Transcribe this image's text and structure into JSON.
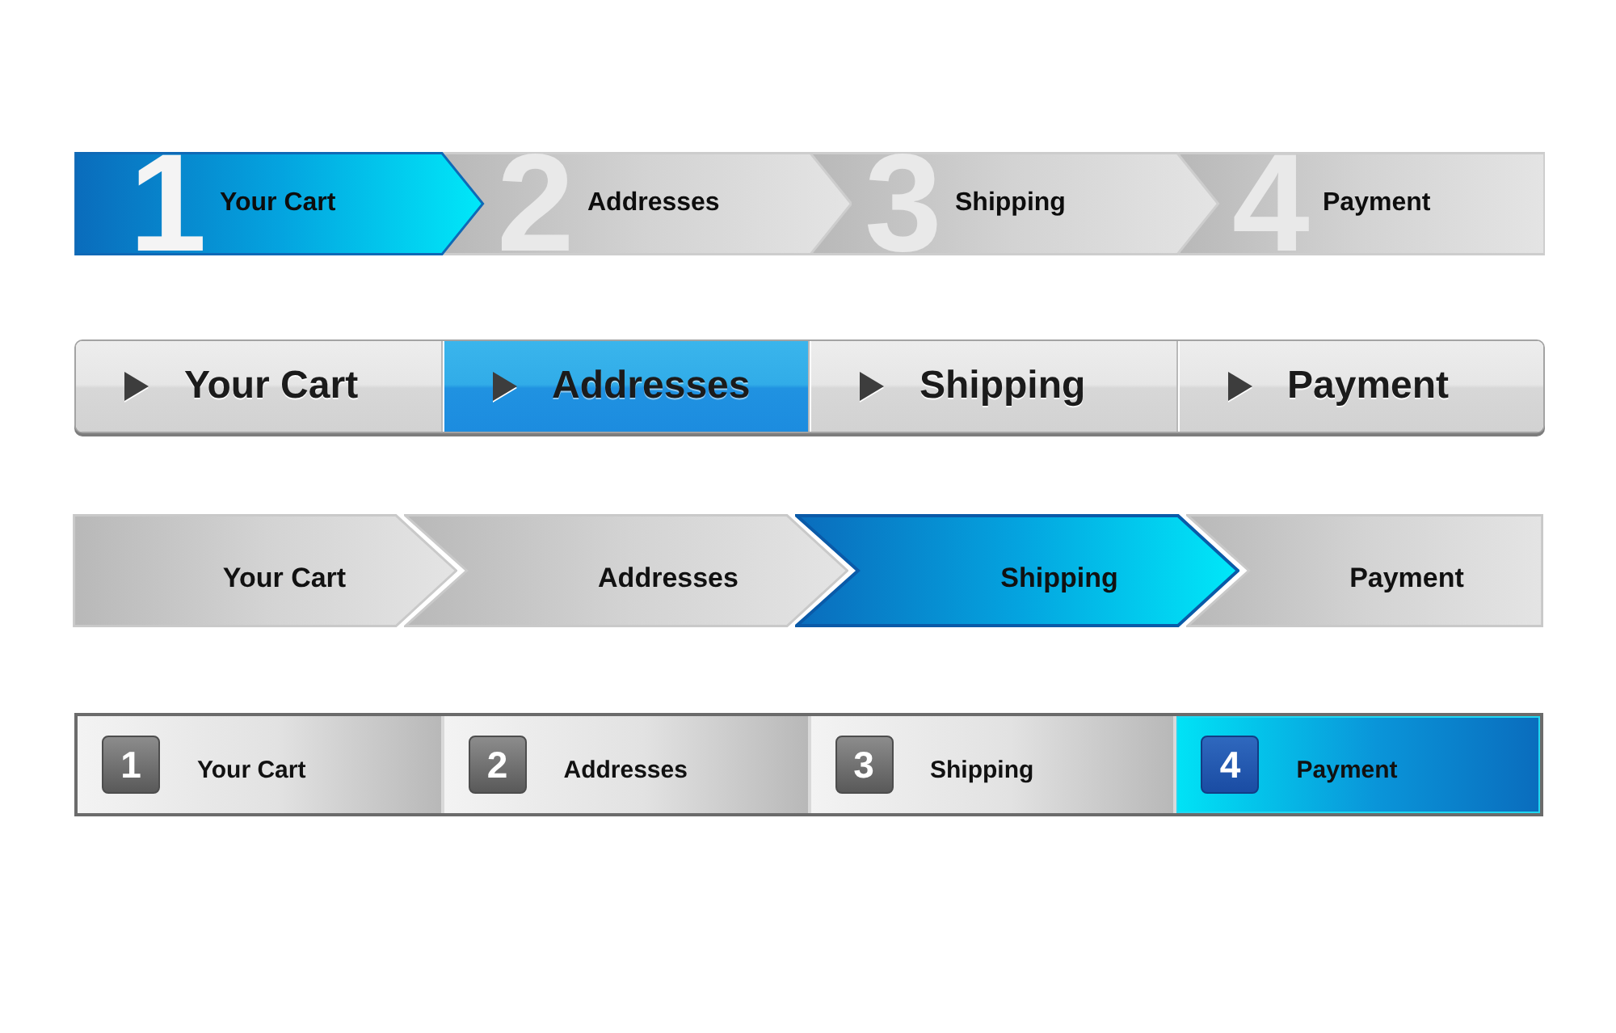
{
  "progress_bars": [
    {
      "kind": "numbered-arrows",
      "steps": [
        {
          "number": "1",
          "label": "Your Cart",
          "selected": true
        },
        {
          "number": "2",
          "label": "Addresses",
          "selected": false
        },
        {
          "number": "3",
          "label": "Shipping",
          "selected": false
        },
        {
          "number": "4",
          "label": "Payment",
          "selected": false
        }
      ]
    },
    {
      "kind": "tabs",
      "steps": [
        {
          "label": "Your Cart",
          "selected": false
        },
        {
          "label": "Addresses",
          "selected": true
        },
        {
          "label": "Shipping",
          "selected": false
        },
        {
          "label": "Payment",
          "selected": false
        }
      ]
    },
    {
      "kind": "chevrons",
      "steps": [
        {
          "label": "Your Cart",
          "selected": false
        },
        {
          "label": "Addresses",
          "selected": false
        },
        {
          "label": "Shipping",
          "selected": true
        },
        {
          "label": "Payment",
          "selected": false
        }
      ]
    },
    {
      "kind": "numbered-boxes",
      "steps": [
        {
          "number": "1",
          "label": "Your Cart",
          "selected": false
        },
        {
          "number": "2",
          "label": "Addresses",
          "selected": false
        },
        {
          "number": "3",
          "label": "Shipping",
          "selected": false
        },
        {
          "number": "4",
          "label": "Payment",
          "selected": true
        }
      ]
    }
  ]
}
